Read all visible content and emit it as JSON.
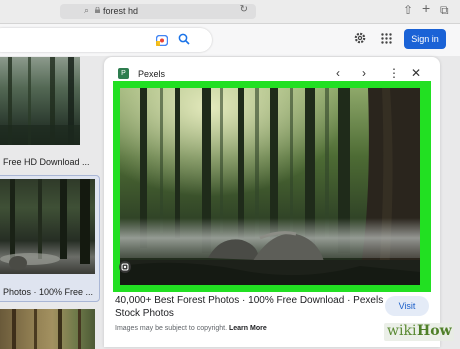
{
  "browser": {
    "url": "forest hd"
  },
  "header": {
    "sign_in": "Sign in"
  },
  "results": {
    "left_captions": [
      "Free HD Download ...",
      "Photos · 100% Free ..."
    ]
  },
  "panel": {
    "source": "Pexels",
    "title": "40,000+ Best Forest Photos · 100% Free Download · Pexels Stock Photos",
    "visit": "Visit",
    "copyright_prefix": "Images may be subject to copyright. ",
    "learn_more": "Learn More",
    "highlight_color": "#22e022"
  },
  "watermark": {
    "wiki": "wiki",
    "how": "How"
  }
}
